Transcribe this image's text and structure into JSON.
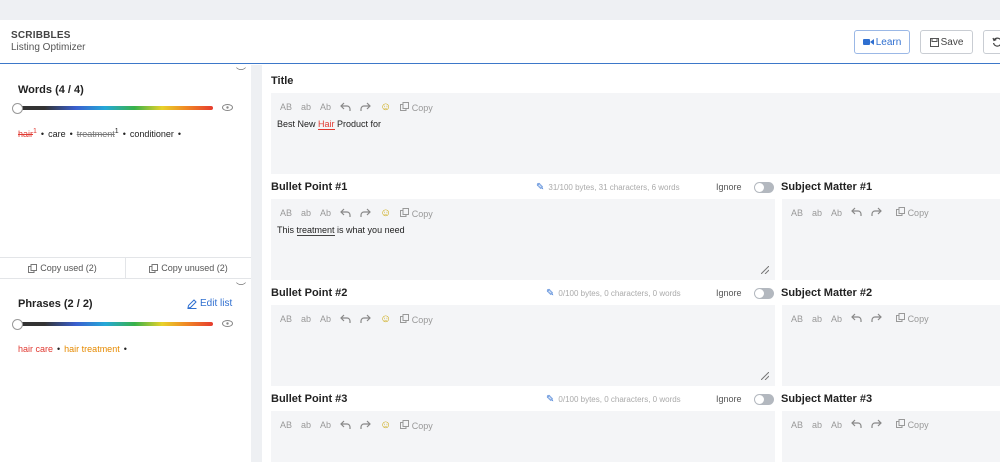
{
  "app": {
    "title": "SCRIBBLES",
    "subtitle": "Listing Optimizer"
  },
  "header": {
    "learn_label": "Learn",
    "save_label": "Save"
  },
  "words": {
    "title": "Words (4 / 4)",
    "items": [
      {
        "text": "hair",
        "count": "1",
        "state": "used-red"
      },
      {
        "text": "care",
        "count": "",
        "state": "normal"
      },
      {
        "text": "treatment",
        "count": "1",
        "state": "used-strike"
      },
      {
        "text": "conditioner",
        "count": "",
        "state": "normal"
      }
    ],
    "copy_used": "Copy used (2)",
    "copy_unused": "Copy unused (2)"
  },
  "phrases": {
    "title": "Phrases (2 / 2)",
    "edit_label": "Edit list",
    "items": [
      {
        "text": "hair care",
        "color": "#e03a32"
      },
      {
        "text": "hair treatment",
        "color": "#e68a00"
      }
    ]
  },
  "toolbar": {
    "btn1": "AB",
    "btn2": "ab",
    "btn3": "Ab",
    "copy_label": "Copy"
  },
  "title_field": {
    "label": "Title",
    "text_before": "Best New ",
    "text_highlight": "Hair",
    "text_after": " Product for"
  },
  "bullets": [
    {
      "label": "Bullet Point #1",
      "stats": "31/100 bytes, 31 characters, 6 words",
      "text_before": "This ",
      "text_highlight": "treatment",
      "text_after": " is what you need"
    },
    {
      "label": "Bullet Point #2",
      "stats": "0/100 bytes, 0 characters, 0 words",
      "text_before": "",
      "text_highlight": "",
      "text_after": ""
    },
    {
      "label": "Bullet Point #3",
      "stats": "0/100 bytes, 0 characters, 0 words",
      "text_before": "",
      "text_highlight": "",
      "text_after": ""
    }
  ],
  "ignore_label": "Ignore",
  "subject_matter": [
    {
      "label": "Subject Matter #1"
    },
    {
      "label": "Subject Matter #2"
    },
    {
      "label": "Subject Matter #3"
    }
  ],
  "colors": {
    "accent": "#2f6fd0",
    "highlight_red": "#e03a32",
    "highlight_orange": "#e68a00"
  }
}
